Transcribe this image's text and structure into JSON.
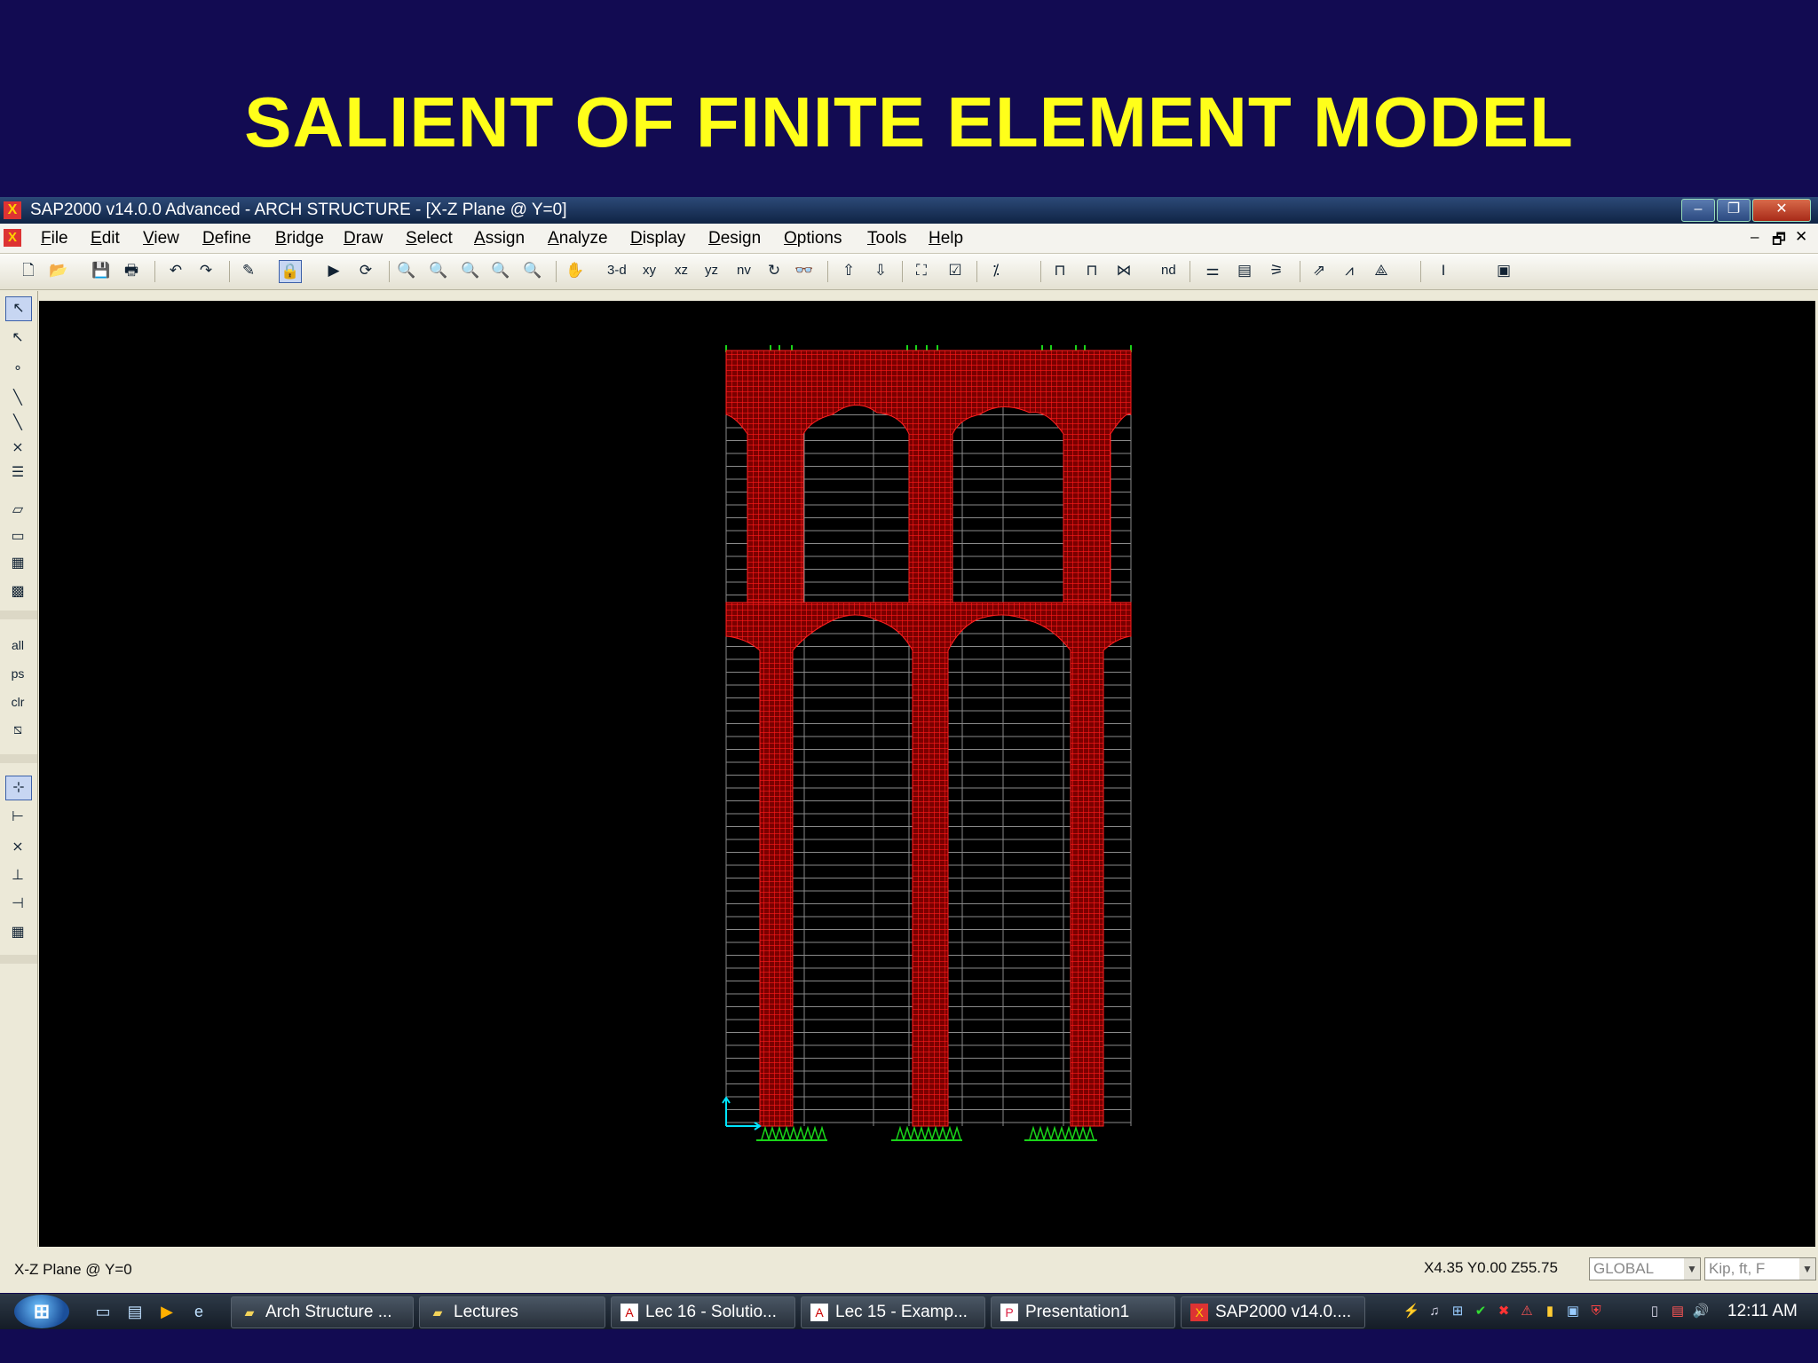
{
  "slide": {
    "title": "SALIENT OF FINITE ELEMENT MODEL"
  },
  "window": {
    "title": "SAP2000 v14.0.0 Advanced  - ARCH STRUCTURE - [X-Z Plane @ Y=0]",
    "minimize": "–",
    "restore": "❐",
    "close": "✕"
  },
  "menu": [
    "File",
    "Edit",
    "View",
    "Define",
    "Bridge",
    "Draw",
    "Select",
    "Assign",
    "Analyze",
    "Display",
    "Design",
    "Options",
    "Tools",
    "Help"
  ],
  "menu_controls": {
    "minimize": "–",
    "restore": "🗗",
    "close": "✕"
  },
  "toolbar": {
    "view_3d": "3-d",
    "view_xy": "xy",
    "view_xz": "xz",
    "view_yz": "yz",
    "view_nv": "nv",
    "view_nd": "nd"
  },
  "left_toolbar": {
    "select_all": "all",
    "previous_selection": "ps",
    "clear_selection": "clr"
  },
  "status": {
    "plane": "X-Z Plane @ Y=0",
    "coords": "X4.35  Y0.00  Z55.75",
    "coord_system": "GLOBAL",
    "units": "Kip, ft, F"
  },
  "taskbar": {
    "start": "⊞",
    "tasks": [
      "Arch Structure ...",
      "Lectures",
      "Lec 16 - Solutio...",
      "Lec 15 - Examp...",
      "Presentation1",
      "SAP2000 v14.0...."
    ],
    "clock": "12:11 AM"
  },
  "colors": {
    "slide_bg": "#120b52",
    "title": "#ffff1a",
    "mesh_red": "#d81010",
    "grid_gray": "#9a9a9a",
    "support_green": "#19d419",
    "axis_cyan": "#00e5ff"
  }
}
